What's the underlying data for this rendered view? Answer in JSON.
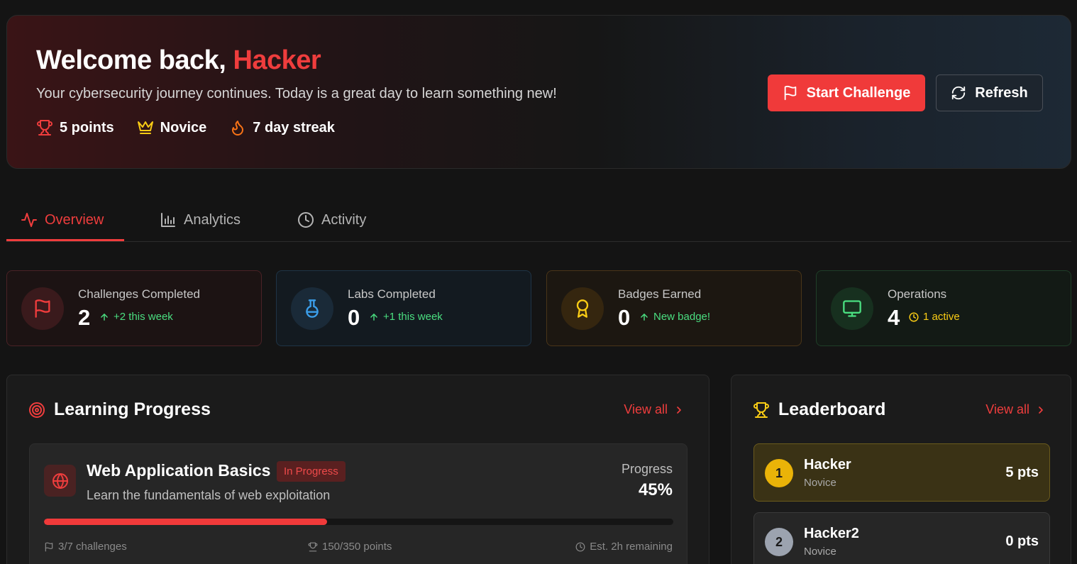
{
  "hero": {
    "greeting": "Welcome back,",
    "username": "Hacker",
    "subtitle": "Your cybersecurity journey continues. Today is a great day to learn something new!",
    "stats": [
      {
        "icon": "trophy-icon",
        "label": "5 points"
      },
      {
        "icon": "crown-icon",
        "label": "Novice"
      },
      {
        "icon": "flame-icon",
        "label": "7 day streak"
      }
    ],
    "primary_button": "Start Challenge",
    "secondary_button": "Refresh"
  },
  "tabs": [
    {
      "label": "Overview",
      "icon": "activity-icon",
      "active": true
    },
    {
      "label": "Analytics",
      "icon": "bar-chart-icon",
      "active": false
    },
    {
      "label": "Activity",
      "icon": "clock-icon",
      "active": false
    }
  ],
  "stat_cards": [
    {
      "label": "Challenges Completed",
      "value": "2",
      "delta": "+2 this week",
      "icon": "flag-icon"
    },
    {
      "label": "Labs Completed",
      "value": "0",
      "delta": "+1 this week",
      "icon": "flask-icon"
    },
    {
      "label": "Badges Earned",
      "value": "0",
      "delta": "New badge!",
      "icon": "award-icon"
    },
    {
      "label": "Operations",
      "value": "4",
      "delta": "1 active",
      "icon": "monitor-icon"
    }
  ],
  "learning": {
    "title": "Learning Progress",
    "view_all": "View all",
    "course": {
      "title": "Web Application Basics",
      "badge": "In Progress",
      "description": "Learn the fundamentals of web exploitation",
      "progress_label": "Progress",
      "progress_value": "45%",
      "progress_fraction": 0.45,
      "challenges": "3/7 challenges",
      "points": "150/350 points",
      "remaining": "Est. 2h remaining"
    }
  },
  "leaderboard": {
    "title": "Leaderboard",
    "view_all": "View all",
    "entries": [
      {
        "rank": "1",
        "name": "Hacker",
        "tier": "Novice",
        "points": "5 pts"
      },
      {
        "rank": "2",
        "name": "Hacker2",
        "tier": "Novice",
        "points": "0 pts"
      }
    ]
  },
  "colors": {
    "accent": "#ef3d3d",
    "success": "#4ade80",
    "warning": "#facc15"
  }
}
